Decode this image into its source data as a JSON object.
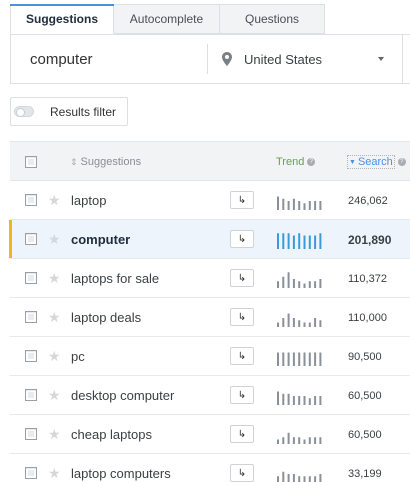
{
  "tabs": [
    {
      "label": "Suggestions",
      "active": true
    },
    {
      "label": "Autocomplete",
      "active": false
    },
    {
      "label": "Questions",
      "active": false
    }
  ],
  "search": {
    "value": "computer"
  },
  "location": {
    "label": "United States",
    "icon": "location-pin-icon"
  },
  "filter": {
    "label": "Results filter"
  },
  "table": {
    "headers": {
      "suggestions": "Suggestions",
      "trend": "Trend",
      "search": "Search"
    },
    "rows": [
      {
        "keyword": "laptop",
        "volume": "246,062",
        "trend": [
          6,
          5,
          4,
          5,
          4,
          3,
          4,
          4,
          4
        ],
        "highlighted": false
      },
      {
        "keyword": "computer",
        "volume": "201,890",
        "trend": [
          7,
          7,
          7,
          6,
          7,
          6,
          6,
          6,
          7
        ],
        "highlighted": true
      },
      {
        "keyword": "laptops for sale",
        "volume": "110,372",
        "trend": [
          3,
          5,
          7,
          4,
          3,
          2,
          3,
          3,
          4
        ],
        "highlighted": false
      },
      {
        "keyword": "laptop deals",
        "volume": "110,000",
        "trend": [
          2,
          4,
          6,
          4,
          3,
          2,
          2,
          4,
          3
        ],
        "highlighted": false
      },
      {
        "keyword": "pc",
        "volume": "90,500",
        "trend": [
          6,
          6,
          6,
          6,
          6,
          6,
          6,
          6,
          6
        ],
        "highlighted": false
      },
      {
        "keyword": "desktop computer",
        "volume": "60,500",
        "trend": [
          6,
          5,
          5,
          4,
          4,
          4,
          3,
          4,
          4
        ],
        "highlighted": false
      },
      {
        "keyword": "cheap laptops",
        "volume": "60,500",
        "trend": [
          2,
          3,
          5,
          3,
          3,
          2,
          3,
          3,
          3
        ],
        "highlighted": false
      },
      {
        "keyword": "laptop computers",
        "volume": "33,199",
        "trend": [
          3,
          5,
          4,
          4,
          3,
          3,
          3,
          3,
          4
        ],
        "highlighted": false
      }
    ]
  },
  "colors": {
    "accent": "#4a90e2",
    "trend_active": "#3a9ad9",
    "trend_default": "#8a9099",
    "highlight_marker": "#f0b429"
  }
}
